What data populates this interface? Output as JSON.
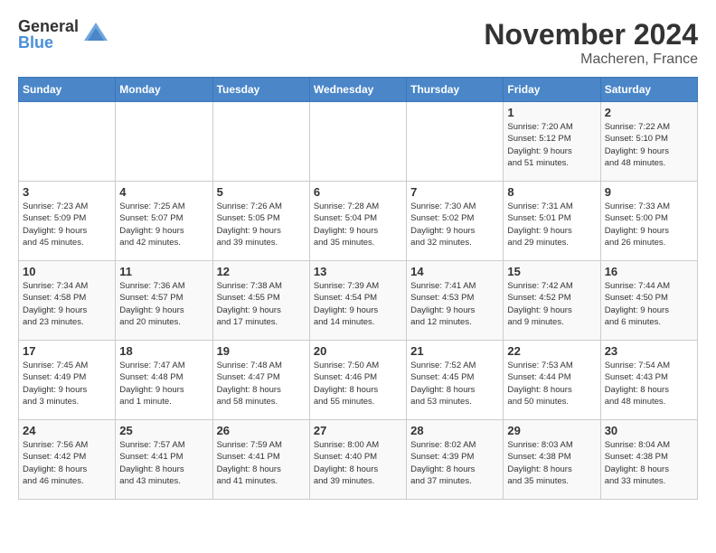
{
  "logo": {
    "general": "General",
    "blue": "Blue"
  },
  "title": "November 2024",
  "location": "Macheren, France",
  "days_of_week": [
    "Sunday",
    "Monday",
    "Tuesday",
    "Wednesday",
    "Thursday",
    "Friday",
    "Saturday"
  ],
  "weeks": [
    [
      {
        "day": "",
        "info": ""
      },
      {
        "day": "",
        "info": ""
      },
      {
        "day": "",
        "info": ""
      },
      {
        "day": "",
        "info": ""
      },
      {
        "day": "",
        "info": ""
      },
      {
        "day": "1",
        "info": "Sunrise: 7:20 AM\nSunset: 5:12 PM\nDaylight: 9 hours\nand 51 minutes."
      },
      {
        "day": "2",
        "info": "Sunrise: 7:22 AM\nSunset: 5:10 PM\nDaylight: 9 hours\nand 48 minutes."
      }
    ],
    [
      {
        "day": "3",
        "info": "Sunrise: 7:23 AM\nSunset: 5:09 PM\nDaylight: 9 hours\nand 45 minutes."
      },
      {
        "day": "4",
        "info": "Sunrise: 7:25 AM\nSunset: 5:07 PM\nDaylight: 9 hours\nand 42 minutes."
      },
      {
        "day": "5",
        "info": "Sunrise: 7:26 AM\nSunset: 5:05 PM\nDaylight: 9 hours\nand 39 minutes."
      },
      {
        "day": "6",
        "info": "Sunrise: 7:28 AM\nSunset: 5:04 PM\nDaylight: 9 hours\nand 35 minutes."
      },
      {
        "day": "7",
        "info": "Sunrise: 7:30 AM\nSunset: 5:02 PM\nDaylight: 9 hours\nand 32 minutes."
      },
      {
        "day": "8",
        "info": "Sunrise: 7:31 AM\nSunset: 5:01 PM\nDaylight: 9 hours\nand 29 minutes."
      },
      {
        "day": "9",
        "info": "Sunrise: 7:33 AM\nSunset: 5:00 PM\nDaylight: 9 hours\nand 26 minutes."
      }
    ],
    [
      {
        "day": "10",
        "info": "Sunrise: 7:34 AM\nSunset: 4:58 PM\nDaylight: 9 hours\nand 23 minutes."
      },
      {
        "day": "11",
        "info": "Sunrise: 7:36 AM\nSunset: 4:57 PM\nDaylight: 9 hours\nand 20 minutes."
      },
      {
        "day": "12",
        "info": "Sunrise: 7:38 AM\nSunset: 4:55 PM\nDaylight: 9 hours\nand 17 minutes."
      },
      {
        "day": "13",
        "info": "Sunrise: 7:39 AM\nSunset: 4:54 PM\nDaylight: 9 hours\nand 14 minutes."
      },
      {
        "day": "14",
        "info": "Sunrise: 7:41 AM\nSunset: 4:53 PM\nDaylight: 9 hours\nand 12 minutes."
      },
      {
        "day": "15",
        "info": "Sunrise: 7:42 AM\nSunset: 4:52 PM\nDaylight: 9 hours\nand 9 minutes."
      },
      {
        "day": "16",
        "info": "Sunrise: 7:44 AM\nSunset: 4:50 PM\nDaylight: 9 hours\nand 6 minutes."
      }
    ],
    [
      {
        "day": "17",
        "info": "Sunrise: 7:45 AM\nSunset: 4:49 PM\nDaylight: 9 hours\nand 3 minutes."
      },
      {
        "day": "18",
        "info": "Sunrise: 7:47 AM\nSunset: 4:48 PM\nDaylight: 9 hours\nand 1 minute."
      },
      {
        "day": "19",
        "info": "Sunrise: 7:48 AM\nSunset: 4:47 PM\nDaylight: 8 hours\nand 58 minutes."
      },
      {
        "day": "20",
        "info": "Sunrise: 7:50 AM\nSunset: 4:46 PM\nDaylight: 8 hours\nand 55 minutes."
      },
      {
        "day": "21",
        "info": "Sunrise: 7:52 AM\nSunset: 4:45 PM\nDaylight: 8 hours\nand 53 minutes."
      },
      {
        "day": "22",
        "info": "Sunrise: 7:53 AM\nSunset: 4:44 PM\nDaylight: 8 hours\nand 50 minutes."
      },
      {
        "day": "23",
        "info": "Sunrise: 7:54 AM\nSunset: 4:43 PM\nDaylight: 8 hours\nand 48 minutes."
      }
    ],
    [
      {
        "day": "24",
        "info": "Sunrise: 7:56 AM\nSunset: 4:42 PM\nDaylight: 8 hours\nand 46 minutes."
      },
      {
        "day": "25",
        "info": "Sunrise: 7:57 AM\nSunset: 4:41 PM\nDaylight: 8 hours\nand 43 minutes."
      },
      {
        "day": "26",
        "info": "Sunrise: 7:59 AM\nSunset: 4:41 PM\nDaylight: 8 hours\nand 41 minutes."
      },
      {
        "day": "27",
        "info": "Sunrise: 8:00 AM\nSunset: 4:40 PM\nDaylight: 8 hours\nand 39 minutes."
      },
      {
        "day": "28",
        "info": "Sunrise: 8:02 AM\nSunset: 4:39 PM\nDaylight: 8 hours\nand 37 minutes."
      },
      {
        "day": "29",
        "info": "Sunrise: 8:03 AM\nSunset: 4:38 PM\nDaylight: 8 hours\nand 35 minutes."
      },
      {
        "day": "30",
        "info": "Sunrise: 8:04 AM\nSunset: 4:38 PM\nDaylight: 8 hours\nand 33 minutes."
      }
    ]
  ]
}
